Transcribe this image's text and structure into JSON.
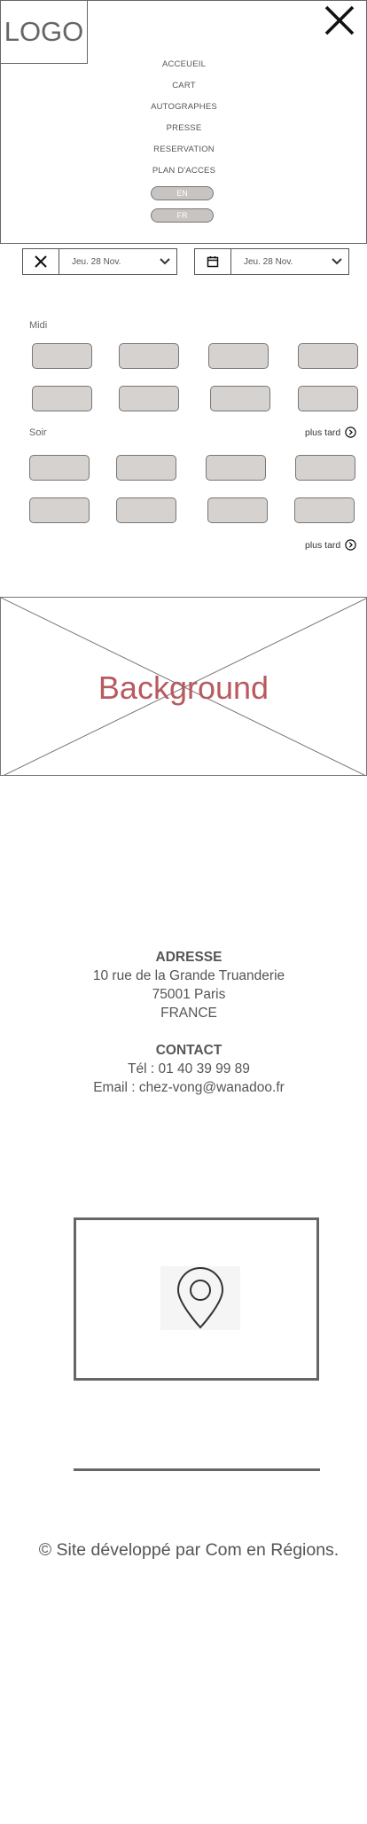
{
  "header": {
    "logo": "LOGO",
    "nav": [
      "ACCEUEIL",
      "CART",
      "AUTOGRAPHES",
      "PRESSE",
      "RESERVATION",
      "PLAN D'ACCES"
    ],
    "languages": [
      "EN",
      "FR"
    ],
    "close_icon": "close-x-icon"
  },
  "booking": {
    "date_picker_1": {
      "icon": "x-icon",
      "value": "Jeu. 28 Nov."
    },
    "date_picker_2": {
      "icon": "calendar-icon",
      "value": "Jeu. 28 Nov."
    },
    "lunch_label": "Midi",
    "evening_label": "Soir",
    "more_label": "plus tard",
    "more_label_2": "plus tard"
  },
  "hero": {
    "label": "Background"
  },
  "address": {
    "title": "ADRESSE",
    "line1": "10 rue de la Grande Truanderie",
    "line2": "75001 Paris",
    "line3": "FRANCE"
  },
  "contact": {
    "title": "CONTACT",
    "phone": "Tél : 01 40 39 99 89",
    "email": "Email : chez-vong@wanadoo.fr"
  },
  "map": {
    "icon": "map-pin-icon"
  },
  "footer": {
    "credit": "© Site développé par Com en Régions."
  },
  "colors": {
    "slot_fill": "#d5d2cf",
    "placeholder_text": "#b85a5f",
    "border": "#666666"
  }
}
